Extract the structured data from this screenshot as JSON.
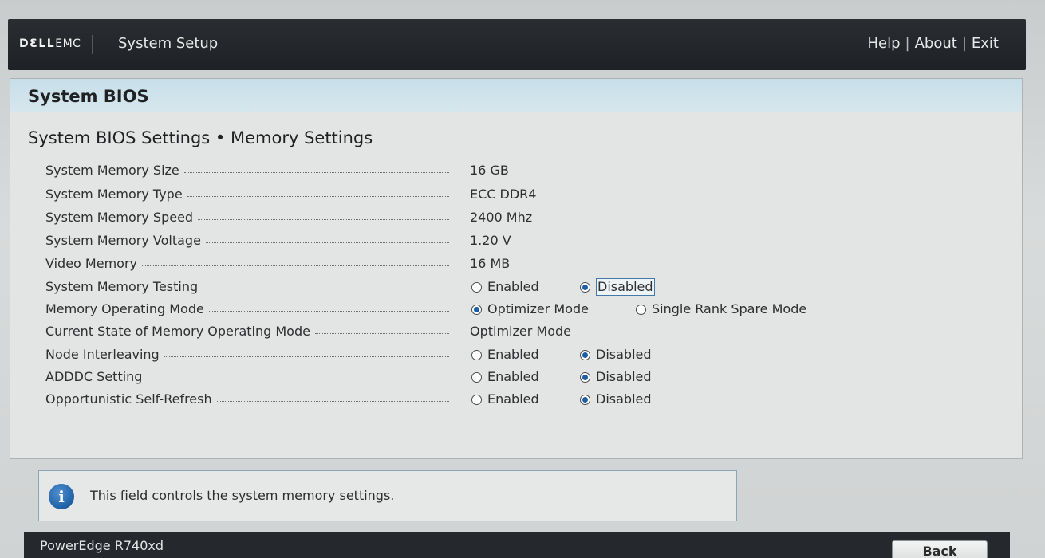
{
  "header": {
    "logo_brand": "DƐLL",
    "logo_suffix": "EMC",
    "app_title": "System Setup",
    "links": {
      "help": "Help",
      "about": "About",
      "exit": "Exit",
      "separator": "|"
    }
  },
  "panel": {
    "title": "System BIOS",
    "breadcrumb": "System BIOS Settings • Memory Settings"
  },
  "settings": [
    {
      "label": "System Memory Size",
      "value": "16 GB"
    },
    {
      "label": "System Memory Type",
      "value": "ECC DDR4"
    },
    {
      "label": "System Memory Speed",
      "value": "2400 Mhz"
    },
    {
      "label": "System Memory Voltage",
      "value": "1.20 V"
    },
    {
      "label": "Video Memory",
      "value": "16 MB"
    },
    {
      "label": "System Memory Testing",
      "options": [
        "Enabled",
        "Disabled"
      ],
      "selected": "Disabled"
    },
    {
      "label": "Memory Operating Mode",
      "options": [
        "Optimizer Mode",
        "Single Rank Spare Mode"
      ],
      "selected": "Optimizer Mode"
    },
    {
      "label": "Current State of Memory Operating Mode",
      "value": "Optimizer Mode"
    },
    {
      "label": "Node Interleaving",
      "options": [
        "Enabled",
        "Disabled"
      ],
      "selected": "Disabled"
    },
    {
      "label": "ADDDC Setting",
      "options": [
        "Enabled",
        "Disabled"
      ],
      "selected": "Disabled"
    },
    {
      "label": "Opportunistic Self-Refresh",
      "options": [
        "Enabled",
        "Disabled"
      ],
      "selected": "Disabled"
    }
  ],
  "help": {
    "text": "This field controls the system memory settings."
  },
  "footer": {
    "model": "PowerEdge R740xd",
    "back_label": "Back"
  },
  "colors": {
    "accent": "#1c5fa8",
    "header_bar": "#1e2125",
    "panel_header": "#c7dfe9"
  },
  "icons": {
    "info": "info-icon"
  }
}
